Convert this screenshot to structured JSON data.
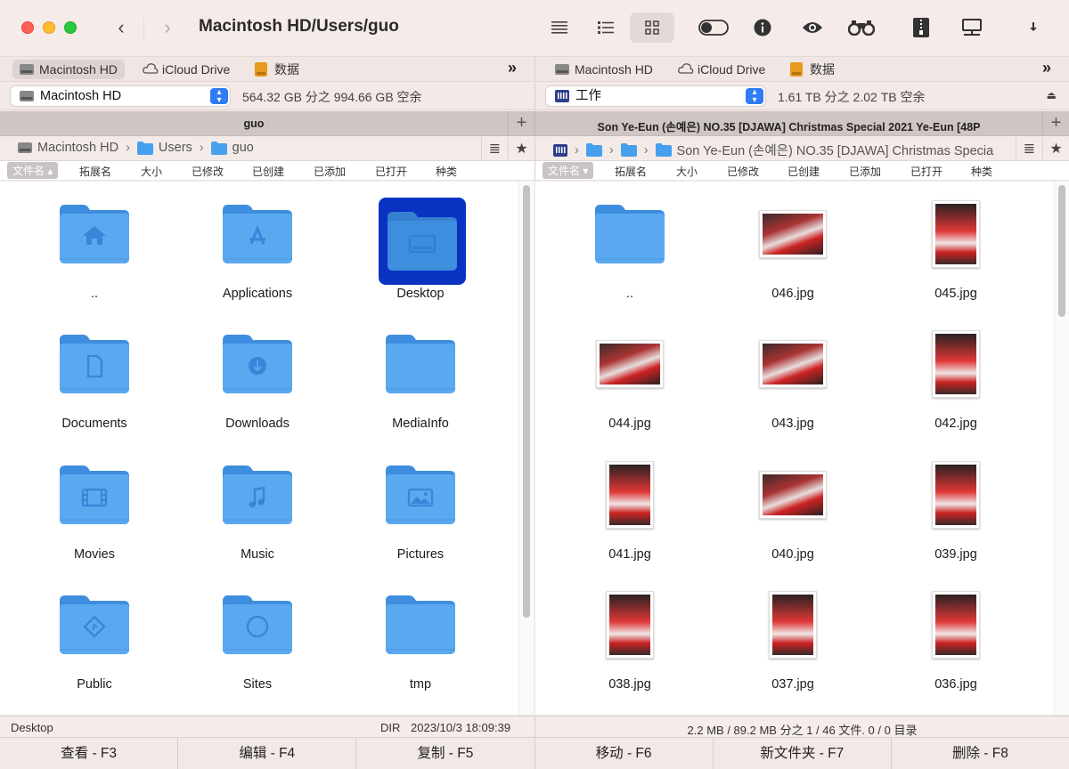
{
  "window": {
    "path_title": "Macintosh HD/Users/guo"
  },
  "devices": [
    "Macintosh HD",
    "iCloud Drive",
    "数据"
  ],
  "left": {
    "volume": "Macintosh HD",
    "free_space": "564.32 GB 分之 994.66 GB 空余",
    "panel_title": "guo",
    "breadcrumb": [
      "Macintosh HD",
      "Users",
      "guo"
    ],
    "columns": [
      "文件名",
      "拓展名",
      "大小",
      "已修改",
      "已创建",
      "已添加",
      "已打开",
      "种类"
    ],
    "items": [
      {
        "name": "..",
        "icon": "home-folder-icon"
      },
      {
        "name": "Applications",
        "icon": "applications-folder-icon"
      },
      {
        "name": "Desktop",
        "icon": "desktop-folder-icon",
        "selected": true
      },
      {
        "name": "Documents",
        "icon": "documents-folder-icon"
      },
      {
        "name": "Downloads",
        "icon": "downloads-folder-icon"
      },
      {
        "name": "MediaInfo",
        "icon": "folder-icon"
      },
      {
        "name": "Movies",
        "icon": "movies-folder-icon"
      },
      {
        "name": "Music",
        "icon": "music-folder-icon"
      },
      {
        "name": "Pictures",
        "icon": "pictures-folder-icon"
      },
      {
        "name": "Public",
        "icon": "public-folder-icon"
      },
      {
        "name": "Sites",
        "icon": "sites-folder-icon"
      },
      {
        "name": "tmp",
        "icon": "folder-icon"
      }
    ],
    "status": {
      "name": "Desktop",
      "kind": "DIR",
      "date": "2023/10/3 18:09:39"
    }
  },
  "right": {
    "volume": "工作",
    "free_space": "1.61 TB 分之 2.02 TB 空余",
    "panel_title": "Son Ye-Eun (손예은) NO.35 [DJAWA] Christmas Special 2021 Ye-Eun [48P",
    "breadcrumb_last": "Son Ye-Eun (손예은) NO.35 [DJAWA] Christmas Specia",
    "columns": [
      "文件名",
      "拓展名",
      "大小",
      "已修改",
      "已创建",
      "已添加",
      "已打开",
      "种类"
    ],
    "items": [
      {
        "name": "..",
        "kind": "folder"
      },
      {
        "name": "046.jpg",
        "kind": "landscape"
      },
      {
        "name": "045.jpg",
        "kind": "portrait"
      },
      {
        "name": "044.jpg",
        "kind": "landscape"
      },
      {
        "name": "043.jpg",
        "kind": "landscape"
      },
      {
        "name": "042.jpg",
        "kind": "portrait"
      },
      {
        "name": "041.jpg",
        "kind": "portrait"
      },
      {
        "name": "040.jpg",
        "kind": "landscape"
      },
      {
        "name": "039.jpg",
        "kind": "portrait"
      },
      {
        "name": "038.jpg",
        "kind": "portrait"
      },
      {
        "name": "037.jpg",
        "kind": "portrait"
      },
      {
        "name": "036.jpg",
        "kind": "portrait"
      }
    ],
    "status": "2.2 MB / 89.2 MB 分之 1 / 46 文件. 0 / 0 目录"
  },
  "function_keys": [
    "查看 - F3",
    "编辑 - F4",
    "复制 - F5",
    "移动 - F6",
    "新文件夹 - F7",
    "删除 - F8"
  ],
  "colors": {
    "folder": "#5aa8f0",
    "folder_dark": "#3d8ede",
    "selection": "#0a33c4",
    "accent": "#2f7cf6"
  }
}
